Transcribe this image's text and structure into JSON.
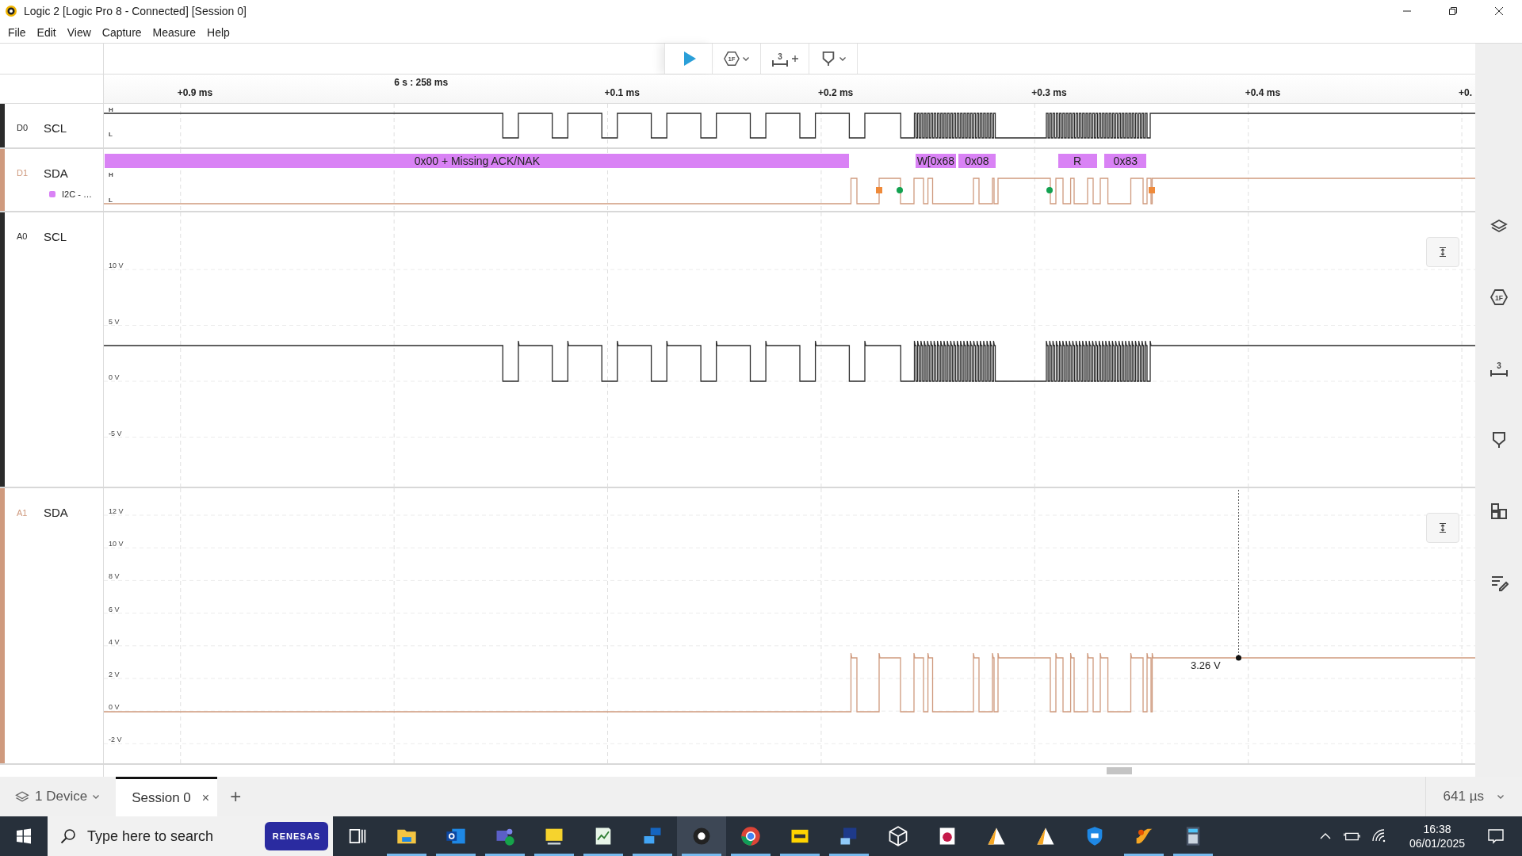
{
  "window": {
    "title": "Logic 2 [Logic Pro 8 - Connected] [Session 0]"
  },
  "menu": [
    "File",
    "Edit",
    "View",
    "Capture",
    "Measure",
    "Help"
  ],
  "toolbar": [
    {
      "kind": "play"
    },
    {
      "kind": "trigger",
      "glyph": "1F"
    },
    {
      "kind": "measure",
      "glyph": "3"
    },
    {
      "kind": "marker"
    }
  ],
  "time_axis": {
    "ticks": [
      {
        "kind": "offset",
        "label": "+0.9 ms"
      },
      {
        "kind": "origin",
        "label": "6 s : 258 ms"
      },
      {
        "kind": "offset",
        "label": "+0.1 ms"
      },
      {
        "kind": "offset",
        "label": "+0.2 ms"
      },
      {
        "kind": "offset",
        "label": "+0.3 ms"
      },
      {
        "kind": "offset",
        "label": "+0.4 ms"
      },
      {
        "kind": "offset",
        "label": "+0."
      }
    ]
  },
  "channels": [
    {
      "id": "D0",
      "name": "SCL",
      "kind": "digital",
      "color": "#2b2b2b",
      "levels": [
        "H",
        "L"
      ]
    },
    {
      "id": "D1",
      "name": "SDA",
      "kind": "digital",
      "color": "#cf9a7e",
      "levels": [
        "H",
        "L"
      ],
      "analyzer": {
        "name": "I2C - …",
        "color": "#d982f5"
      },
      "frames": [
        "0x00 + Missing ACK/NAK",
        "W[0x68",
        "0x08",
        "R",
        "0x83"
      ]
    },
    {
      "id": "A0",
      "name": "SCL",
      "kind": "analog",
      "color": "#2b2b2b",
      "ticks": [
        "10 V",
        "5 V",
        "0 V",
        "-5 V"
      ]
    },
    {
      "id": "A1",
      "name": "SDA",
      "kind": "analog",
      "color": "#cf9a7e",
      "ticks": [
        "12 V",
        "10 V",
        "8 V",
        "6 V",
        "4 V",
        "2 V",
        "0 V",
        "-2 V"
      ],
      "measurement": "3.26 V"
    }
  ],
  "sidebar": [
    {
      "kind": "device"
    },
    {
      "kind": "analyzers",
      "glyph": "1F"
    },
    {
      "kind": "measure",
      "glyph": "3"
    },
    {
      "kind": "marker"
    },
    {
      "kind": "layout"
    },
    {
      "kind": "notes"
    }
  ],
  "bottom_bar": {
    "device": "1 Device",
    "tabs": [
      {
        "label": "Session 0",
        "close": "×",
        "selected": true
      }
    ],
    "add": "+",
    "zoom": "641 µs"
  },
  "taskbar": {
    "search": {
      "placeholder": "Type here to search"
    },
    "badge": "RENESAS",
    "apps": [
      {
        "kind": "taskview",
        "running": false,
        "selected": false
      },
      {
        "kind": "folder",
        "running": true,
        "selected": false
      },
      {
        "kind": "mail",
        "running": true,
        "selected": false
      },
      {
        "kind": "chat",
        "running": true,
        "selected": false
      },
      {
        "kind": "monitor",
        "running": true,
        "selected": false
      },
      {
        "kind": "chart",
        "running": true,
        "selected": false
      },
      {
        "kind": "network",
        "running": true,
        "selected": false
      },
      {
        "kind": "logic",
        "running": true,
        "selected": true
      },
      {
        "kind": "browser",
        "running": true,
        "selected": false
      },
      {
        "kind": "pdf",
        "running": true,
        "selected": false
      },
      {
        "kind": "network2",
        "running": true,
        "selected": false
      },
      {
        "kind": "cube",
        "running": false,
        "selected": false
      },
      {
        "kind": "board",
        "running": false,
        "selected": false
      },
      {
        "kind": "triangle",
        "running": false,
        "selected": false
      },
      {
        "kind": "triangle",
        "running": false,
        "selected": false
      },
      {
        "kind": "shield",
        "running": false,
        "selected": false
      },
      {
        "kind": "swoosh",
        "running": true,
        "selected": false
      },
      {
        "kind": "calculator",
        "running": true,
        "selected": false
      }
    ],
    "tray": {
      "time": "16:38",
      "date": "06/01/2025"
    }
  }
}
